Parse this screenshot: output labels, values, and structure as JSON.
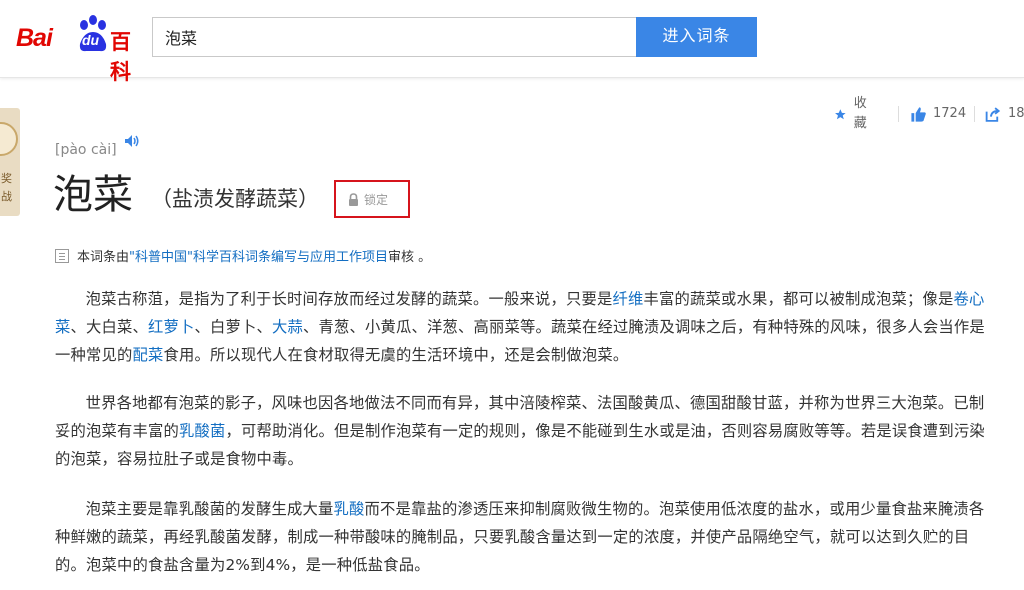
{
  "header": {
    "logo": {
      "latin": "Bai",
      "du": "du",
      "baike": "百科"
    },
    "search_value": "泡菜",
    "search_button": "进入词条"
  },
  "left_tab": {
    "chars": [
      "奖",
      "战"
    ]
  },
  "toolbar": {
    "collect": "收藏",
    "likes": "1724",
    "shares": "18"
  },
  "entry": {
    "pinyin": "[pào cài]",
    "title": "泡菜",
    "subtitle": "（盐渍发酵蔬菜）",
    "lock": "锁定"
  },
  "notice": {
    "prefix": "本词条由",
    "link1": "\"科普中国\"",
    "link2": "科学百科词条编写与应用工作项目",
    "suffix": " 审核 。"
  },
  "paragraphs": [
    [
      {
        "t": "泡菜古称菹，是指为了利于长时间存放而经过发酵的蔬菜。一般来说，只要是"
      },
      {
        "t": "纤维",
        "link": true
      },
      {
        "t": "丰富的蔬菜或水果，都可以被制成泡菜；像是"
      },
      {
        "t": "卷心菜",
        "link": true
      },
      {
        "t": "、大白菜、"
      },
      {
        "t": "红萝卜",
        "link": true
      },
      {
        "t": "、白萝卜、"
      },
      {
        "t": "大蒜",
        "link": true
      },
      {
        "t": "、青葱、小黄瓜、洋葱、高丽菜等。蔬菜在经过腌渍及调味之后，有种特殊的风味，很多人会当作是一种常见的"
      },
      {
        "t": "配菜",
        "link": true
      },
      {
        "t": "食用。所以现代人在食材取得无虞的生活环境中，还是会制做泡菜。"
      }
    ],
    [
      {
        "t": "世界各地都有泡菜的影子，风味也因各地做法不同而有异，其中涪陵榨菜、法国酸黄瓜、德国甜酸甘蓝，并称为世界三大泡菜。已制妥的泡菜有丰富的"
      },
      {
        "t": "乳酸菌",
        "link": true
      },
      {
        "t": "，可帮助消化。但是制作泡菜有一定的规则，像是不能碰到生水或是油，否则容易腐败等等。若是误食遭到污染的泡菜，容易拉肚子或是食物中毒。"
      }
    ],
    [
      {
        "t": "泡菜主要是靠乳酸菌的发酵生成大量"
      },
      {
        "t": "乳酸",
        "link": true
      },
      {
        "t": "而不是靠盐的渗透压来抑制腐败微生物的。泡菜使用低浓度的盐水，或用少量食盐来腌渍各种鲜嫩的蔬菜，再经乳酸菌发酵，制成一种带酸味的腌制品，只要乳酸含量达到一定的浓度，并使产品隔绝空气，就可以达到久贮的目的。泡菜中的食盐含量为2%到4%，是一种低盐食品。"
      }
    ]
  ],
  "colors": {
    "brand_red": "#e10602",
    "brand_blue": "#2932e1",
    "button_blue": "#3a86e6",
    "link_blue": "#136ec2",
    "highlight_red": "#d6141c"
  }
}
